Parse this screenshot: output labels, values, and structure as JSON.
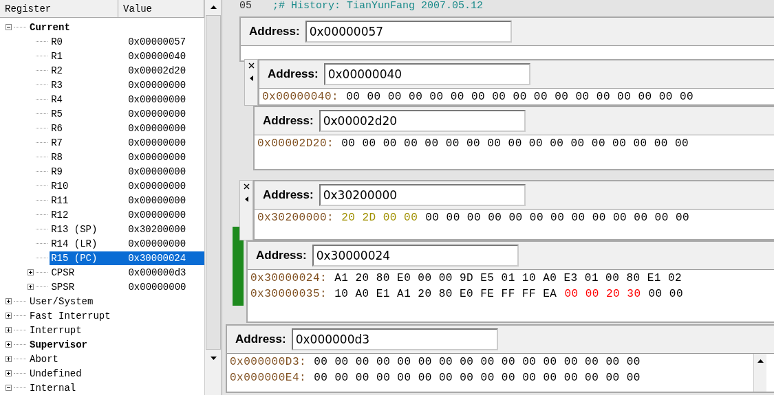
{
  "register_panel": {
    "columns": [
      "Register",
      "Value"
    ],
    "tree": [
      {
        "label": "Current",
        "bold": true,
        "expanded": true,
        "selected": false,
        "children": [
          {
            "label": "R0",
            "value": "0x00000057",
            "selected": false
          },
          {
            "label": "R1",
            "value": "0x00000040",
            "selected": false
          },
          {
            "label": "R2",
            "value": "0x00002d20",
            "selected": false
          },
          {
            "label": "R3",
            "value": "0x00000000",
            "selected": false
          },
          {
            "label": "R4",
            "value": "0x00000000",
            "selected": false
          },
          {
            "label": "R5",
            "value": "0x00000000",
            "selected": false
          },
          {
            "label": "R6",
            "value": "0x00000000",
            "selected": false
          },
          {
            "label": "R7",
            "value": "0x00000000",
            "selected": false
          },
          {
            "label": "R8",
            "value": "0x00000000",
            "selected": false
          },
          {
            "label": "R9",
            "value": "0x00000000",
            "selected": false
          },
          {
            "label": "R10",
            "value": "0x00000000",
            "selected": false
          },
          {
            "label": "R11",
            "value": "0x00000000",
            "selected": false
          },
          {
            "label": "R12",
            "value": "0x00000000",
            "selected": false
          },
          {
            "label": "R13 (SP)",
            "value": "0x30200000",
            "selected": false
          },
          {
            "label": "R14 (LR)",
            "value": "0x00000000",
            "selected": false
          },
          {
            "label": "R15 (PC)",
            "value": "0x30000024",
            "selected": true
          },
          {
            "label": "CPSR",
            "value": "0x000000d3",
            "expanded": false,
            "selected": false
          },
          {
            "label": "SPSR",
            "value": "0x00000000",
            "expanded": false,
            "selected": false
          }
        ]
      },
      {
        "label": "User/System",
        "bold": false,
        "expanded": false,
        "selected": false
      },
      {
        "label": "Fast Interrupt",
        "bold": false,
        "expanded": false,
        "selected": false
      },
      {
        "label": "Interrupt",
        "bold": false,
        "expanded": false,
        "selected": false
      },
      {
        "label": "Supervisor",
        "bold": true,
        "expanded": false,
        "selected": false
      },
      {
        "label": "Abort",
        "bold": false,
        "expanded": false,
        "selected": false
      },
      {
        "label": "Undefined",
        "bold": false,
        "expanded": false,
        "selected": false
      },
      {
        "label": "Internal",
        "bold": false,
        "expanded": true,
        "selected": false
      }
    ]
  },
  "editor": {
    "line_number": "05",
    "comment": ";# History: TianYunFang 2007.05.12"
  },
  "memory_windows": [
    {
      "label": "Address:",
      "address": "0x00000057"
    },
    {
      "label": "Address:",
      "address": "0x00000040",
      "rows": [
        {
          "address": "0x00000040:",
          "segments": [
            {
              "text": "00 00 00 00 00 00 00 00 00 00 00 00 00 00 00 00 00",
              "color": "#000000"
            }
          ]
        }
      ]
    },
    {
      "label": "Address:",
      "address": "0x00002d20",
      "rows": [
        {
          "address": "0x00002D20:",
          "segments": [
            {
              "text": "00 00 00 00 00 00 00 00 00 00 00 00 00 00 00 00 00",
              "color": "#000000"
            }
          ]
        }
      ]
    },
    {
      "label": "Address:",
      "address": "0x30200000",
      "rows": [
        {
          "address": "0x30200000:",
          "segments": [
            {
              "text": "20 2D 00 00",
              "color": "#a09000"
            },
            {
              "text": "00 00 00 00 00 00 00 00 00 00 00 00 00",
              "color": "#000000"
            }
          ]
        }
      ]
    },
    {
      "label": "Address:",
      "address": "0x30000024",
      "rows": [
        {
          "address": "0x30000024:",
          "segments": [
            {
              "text": "A1 20 80 E0 00 00 9D E5 01 10 A0 E3 01 00 80 E1 02",
              "color": "#000000"
            }
          ]
        },
        {
          "address": "0x30000035:",
          "segments": [
            {
              "text": "10 A0 E1 A1 20 80 E0 FE FF FF EA",
              "color": "#000000"
            },
            {
              "text": "00 00 20 30",
              "color": "#ff0000"
            },
            {
              "text": "00 00",
              "color": "#000000"
            }
          ]
        }
      ]
    },
    {
      "label": "Address:",
      "address": "0x000000d3",
      "rows": [
        {
          "address": "0x000000D3:",
          "segments": [
            {
              "text": "00 00 00 00 00 00 00 00 00 00 00 00 00 00 00 00",
              "color": "#000000"
            }
          ]
        },
        {
          "address": "0x000000E4:",
          "segments": [
            {
              "text": "00 00 00 00 00 00 00 00 00 00 00 00 00 00 00 00",
              "color": "#000000"
            }
          ]
        }
      ]
    }
  ]
}
